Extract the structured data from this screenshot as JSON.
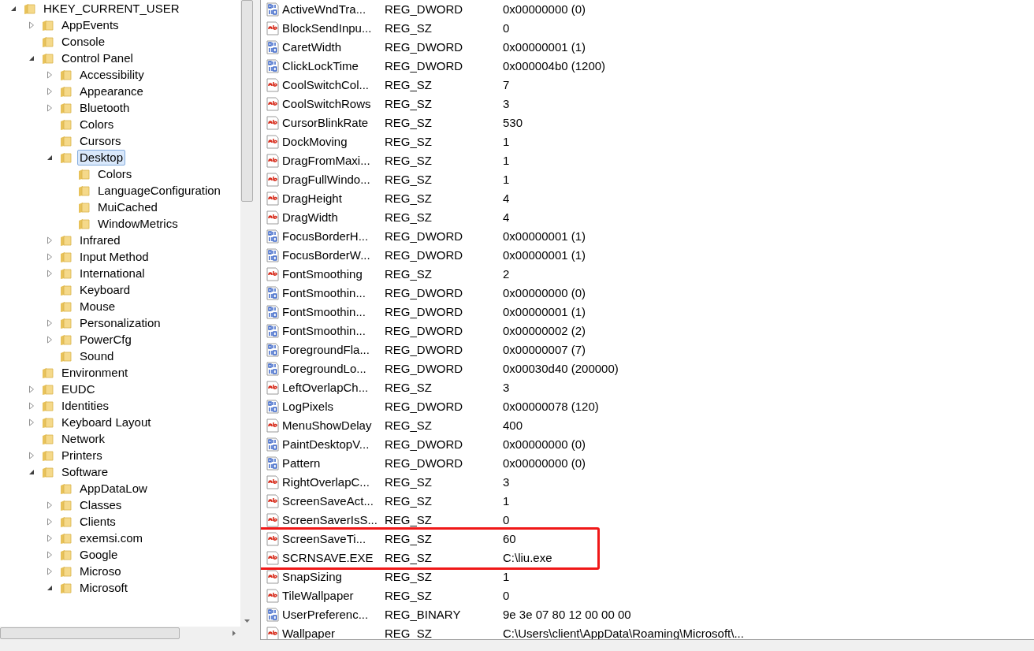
{
  "tree": [
    {
      "label": "HKEY_CURRENT_USER",
      "expanded": true,
      "selected": false,
      "children": [
        {
          "label": "AppEvents",
          "expanded": false,
          "selected": false
        },
        {
          "label": "Console",
          "selected": false
        },
        {
          "label": "Control Panel",
          "expanded": true,
          "selected": false,
          "children": [
            {
              "label": "Accessibility",
              "expanded": false,
              "selected": false
            },
            {
              "label": "Appearance",
              "expanded": false,
              "selected": false
            },
            {
              "label": "Bluetooth",
              "expanded": false,
              "selected": false
            },
            {
              "label": "Colors",
              "selected": false
            },
            {
              "label": "Cursors",
              "selected": false
            },
            {
              "label": "Desktop",
              "expanded": true,
              "selected": true,
              "children": [
                {
                  "label": "Colors",
                  "selected": false
                },
                {
                  "label": "LanguageConfiguration",
                  "selected": false
                },
                {
                  "label": "MuiCached",
                  "selected": false
                },
                {
                  "label": "WindowMetrics",
                  "selected": false
                }
              ]
            },
            {
              "label": "Infrared",
              "expanded": false,
              "selected": false
            },
            {
              "label": "Input Method",
              "expanded": false,
              "selected": false
            },
            {
              "label": "International",
              "expanded": false,
              "selected": false
            },
            {
              "label": "Keyboard",
              "selected": false
            },
            {
              "label": "Mouse",
              "selected": false
            },
            {
              "label": "Personalization",
              "expanded": false,
              "selected": false
            },
            {
              "label": "PowerCfg",
              "expanded": false,
              "selected": false
            },
            {
              "label": "Sound",
              "selected": false
            }
          ]
        },
        {
          "label": "Environment",
          "selected": false
        },
        {
          "label": "EUDC",
          "expanded": false,
          "selected": false
        },
        {
          "label": "Identities",
          "expanded": false,
          "selected": false
        },
        {
          "label": "Keyboard Layout",
          "expanded": false,
          "selected": false
        },
        {
          "label": "Network",
          "selected": false
        },
        {
          "label": "Printers",
          "expanded": false,
          "selected": false
        },
        {
          "label": "Software",
          "expanded": true,
          "selected": false,
          "children": [
            {
              "label": "AppDataLow",
              "selected": false
            },
            {
              "label": "Classes",
              "expanded": false,
              "selected": false
            },
            {
              "label": "Clients",
              "expanded": false,
              "selected": false
            },
            {
              "label": "exemsi.com",
              "expanded": false,
              "selected": false
            },
            {
              "label": "Google",
              "expanded": false,
              "selected": false
            },
            {
              "label": "Microso",
              "expanded": false,
              "selected": false
            },
            {
              "label": "Microsoft",
              "expanded": true,
              "selected": false
            }
          ]
        }
      ]
    }
  ],
  "values": [
    {
      "kind": "binary",
      "name": "ActiveWndTra...",
      "type": "REG_DWORD",
      "data": "0x00000000 (0)"
    },
    {
      "kind": "string",
      "name": "BlockSendInpu...",
      "type": "REG_SZ",
      "data": "0"
    },
    {
      "kind": "binary",
      "name": "CaretWidth",
      "type": "REG_DWORD",
      "data": "0x00000001 (1)"
    },
    {
      "kind": "binary",
      "name": "ClickLockTime",
      "type": "REG_DWORD",
      "data": "0x000004b0 (1200)"
    },
    {
      "kind": "string",
      "name": "CoolSwitchCol...",
      "type": "REG_SZ",
      "data": "7"
    },
    {
      "kind": "string",
      "name": "CoolSwitchRows",
      "type": "REG_SZ",
      "data": "3"
    },
    {
      "kind": "string",
      "name": "CursorBlinkRate",
      "type": "REG_SZ",
      "data": "530"
    },
    {
      "kind": "string",
      "name": "DockMoving",
      "type": "REG_SZ",
      "data": "1"
    },
    {
      "kind": "string",
      "name": "DragFromMaxi...",
      "type": "REG_SZ",
      "data": "1"
    },
    {
      "kind": "string",
      "name": "DragFullWindo...",
      "type": "REG_SZ",
      "data": "1"
    },
    {
      "kind": "string",
      "name": "DragHeight",
      "type": "REG_SZ",
      "data": "4"
    },
    {
      "kind": "string",
      "name": "DragWidth",
      "type": "REG_SZ",
      "data": "4"
    },
    {
      "kind": "binary",
      "name": "FocusBorderH...",
      "type": "REG_DWORD",
      "data": "0x00000001 (1)"
    },
    {
      "kind": "binary",
      "name": "FocusBorderW...",
      "type": "REG_DWORD",
      "data": "0x00000001 (1)"
    },
    {
      "kind": "string",
      "name": "FontSmoothing",
      "type": "REG_SZ",
      "data": "2"
    },
    {
      "kind": "binary",
      "name": "FontSmoothin...",
      "type": "REG_DWORD",
      "data": "0x00000000 (0)"
    },
    {
      "kind": "binary",
      "name": "FontSmoothin...",
      "type": "REG_DWORD",
      "data": "0x00000001 (1)"
    },
    {
      "kind": "binary",
      "name": "FontSmoothin...",
      "type": "REG_DWORD",
      "data": "0x00000002 (2)"
    },
    {
      "kind": "binary",
      "name": "ForegroundFla...",
      "type": "REG_DWORD",
      "data": "0x00000007 (7)"
    },
    {
      "kind": "binary",
      "name": "ForegroundLo...",
      "type": "REG_DWORD",
      "data": "0x00030d40 (200000)"
    },
    {
      "kind": "string",
      "name": "LeftOverlapCh...",
      "type": "REG_SZ",
      "data": "3"
    },
    {
      "kind": "binary",
      "name": "LogPixels",
      "type": "REG_DWORD",
      "data": "0x00000078 (120)"
    },
    {
      "kind": "string",
      "name": "MenuShowDelay",
      "type": "REG_SZ",
      "data": "400"
    },
    {
      "kind": "binary",
      "name": "PaintDesktopV...",
      "type": "REG_DWORD",
      "data": "0x00000000 (0)"
    },
    {
      "kind": "binary",
      "name": "Pattern",
      "type": "REG_DWORD",
      "data": "0x00000000 (0)"
    },
    {
      "kind": "string",
      "name": "RightOverlapC...",
      "type": "REG_SZ",
      "data": "3"
    },
    {
      "kind": "string",
      "name": "ScreenSaveAct...",
      "type": "REG_SZ",
      "data": "1"
    },
    {
      "kind": "string",
      "name": "ScreenSaverIsS...",
      "type": "REG_SZ",
      "data": "0"
    },
    {
      "kind": "string",
      "name": "ScreenSaveTi...",
      "type": "REG_SZ",
      "data": "60",
      "highlighted": true
    },
    {
      "kind": "string",
      "name": "SCRNSAVE.EXE",
      "type": "REG_SZ",
      "data": "C:\\liu.exe",
      "highlighted": true
    },
    {
      "kind": "string",
      "name": "SnapSizing",
      "type": "REG_SZ",
      "data": "1"
    },
    {
      "kind": "string",
      "name": "TileWallpaper",
      "type": "REG_SZ",
      "data": "0"
    },
    {
      "kind": "binary",
      "name": "UserPreferenc...",
      "type": "REG_BINARY",
      "data": "9e 3e 07 80 12 00 00 00"
    },
    {
      "kind": "string",
      "name": "Wallpaper",
      "type": "REG_SZ",
      "data": "C:\\Users\\client\\AppData\\Roaming\\Microsoft\\..."
    }
  ]
}
